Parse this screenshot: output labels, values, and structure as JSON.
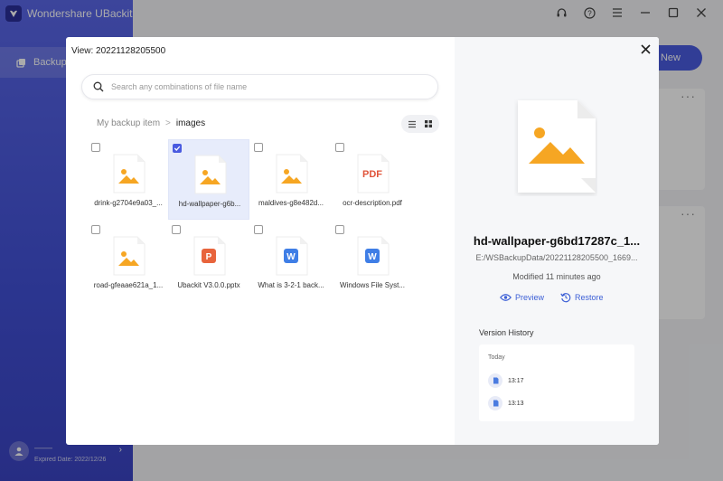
{
  "app": {
    "title": "Wondershare UBackit",
    "sidebar_backup_label": "Backup",
    "user_name": "––––",
    "expired_date": "Expired Date: 2022/12/26",
    "new_button": "New"
  },
  "modal": {
    "title": "View: 20221128205500",
    "search_placeholder": "Search any combinations of file name",
    "breadcrumb": {
      "root": "My backup item",
      "separator": ">",
      "current": "images"
    },
    "files": [
      {
        "name": "drink-g2704e9a03_...",
        "type": "image",
        "checked": false
      },
      {
        "name": "hd-wallpaper-g6b...",
        "type": "image",
        "checked": true
      },
      {
        "name": "maldives-g8e482d...",
        "type": "image",
        "checked": false
      },
      {
        "name": "ocr-description.pdf",
        "type": "pdf",
        "checked": false,
        "badge": "PDF"
      },
      {
        "name": "road-gfeaae621a_1...",
        "type": "image",
        "checked": false
      },
      {
        "name": "Ubackit V3.0.0.pptx",
        "type": "pptx",
        "checked": false,
        "badge": "P"
      },
      {
        "name": "What is 3-2-1 back...",
        "type": "docx",
        "checked": false,
        "badge": "W"
      },
      {
        "name": "Windows File Syst...",
        "type": "docx",
        "checked": false,
        "badge": "W"
      }
    ]
  },
  "detail": {
    "name": "hd-wallpaper-g6bd17287c_1...",
    "path": "E:/WSBackupData/20221128205500_1669...",
    "modified": "Modified 11 minutes ago",
    "preview_label": "Preview",
    "restore_label": "Restore",
    "version_history_title": "Version History",
    "today_label": "Today",
    "versions": [
      "13:17",
      "13:13"
    ]
  },
  "colors": {
    "accent": "#4a5be0",
    "image_icon": "#f6a623",
    "pdf": "#e0543a",
    "pptx": "#e8643c",
    "docx": "#3f7ee6",
    "link": "#3c5fd6"
  }
}
